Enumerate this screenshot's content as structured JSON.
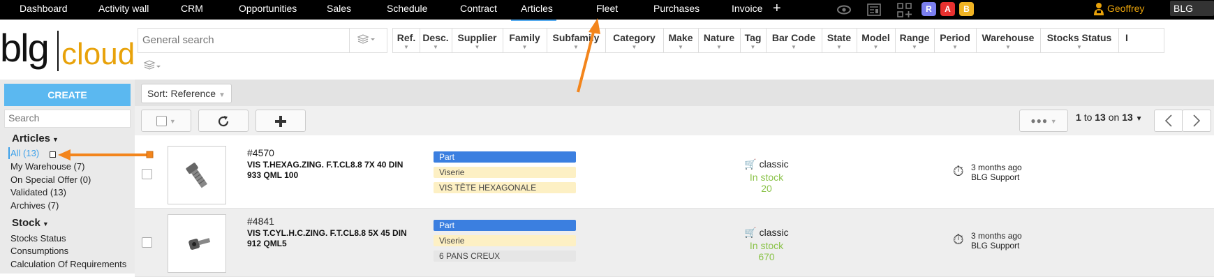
{
  "topnav": {
    "items": [
      "Dashboard",
      "Activity wall",
      "CRM",
      "Opportunities",
      "Sales",
      "Schedule",
      "Contract",
      "Articles",
      "Fleet",
      "Purchases",
      "Invoice"
    ],
    "active_index": 7,
    "add_label": "+",
    "badges": [
      {
        "label": "R",
        "color": "#7b7ff0"
      },
      {
        "label": "A",
        "color": "#e8312f"
      },
      {
        "label": "B",
        "color": "#f0b323"
      }
    ],
    "user": "Geoffrey",
    "tenant": "BLG Support"
  },
  "logo": {
    "blg": "blg",
    "cloud": "cloud"
  },
  "search": {
    "placeholder": "General search"
  },
  "filters": [
    "Ref.",
    "Desc.",
    "Supplier",
    "Family",
    "Subfamily",
    "Category",
    "Make",
    "Nature",
    "Tag",
    "Bar Code",
    "State",
    "Model",
    "Range",
    "Period",
    "Warehouse",
    "Stocks Status",
    "I"
  ],
  "left": {
    "create_label": "CREATE",
    "search_placeholder": "Search",
    "articles_heading": "Articles",
    "articles_items": [
      "All (13)",
      "My Warehouse (7)",
      "On Special Offer (0)",
      "Validated (13)",
      "Archives (7)"
    ],
    "stock_heading": "Stock",
    "stock_items": [
      "Stocks Status",
      "Consumptions",
      "Calculation Of Requirements"
    ]
  },
  "sort": {
    "label": "Sort: Reference"
  },
  "pager": {
    "from": "1",
    "to_word": "to",
    "to": "13",
    "on_word": "on",
    "total": "13"
  },
  "rows": [
    {
      "ref": "#4570",
      "desc": "VIS T.HEXAG.ZING. F.T.CL8.8 7X 40 DIN 933 QML 100",
      "tags": [
        {
          "label": "Part",
          "style": "blue"
        },
        {
          "label": "Viserie",
          "style": "yellow"
        },
        {
          "label": "VIS TÊTE HEXAGONALE",
          "style": "yellow"
        }
      ],
      "pricing": "classic",
      "stock_status": "In stock",
      "qty": "20",
      "updated": "3 months ago",
      "updated_by": "BLG Support"
    },
    {
      "ref": "#4841",
      "desc": "VIS T.CYL.H.C.ZING. F.T.CL8.8 5X 45 DIN 912 QML5",
      "tags": [
        {
          "label": "Part",
          "style": "blue"
        },
        {
          "label": "Viserie",
          "style": "yellow"
        },
        {
          "label": "6 PANS CREUX",
          "style": "grey"
        }
      ],
      "pricing": "classic",
      "stock_status": "In stock",
      "qty": "670",
      "updated": "3 months ago",
      "updated_by": "BLG Support"
    }
  ],
  "colors": {
    "accent": "#5bb8f0",
    "arrow": "#f3851c",
    "brand_orange": "#e8a20a",
    "in_stock": "#8bc34a"
  }
}
